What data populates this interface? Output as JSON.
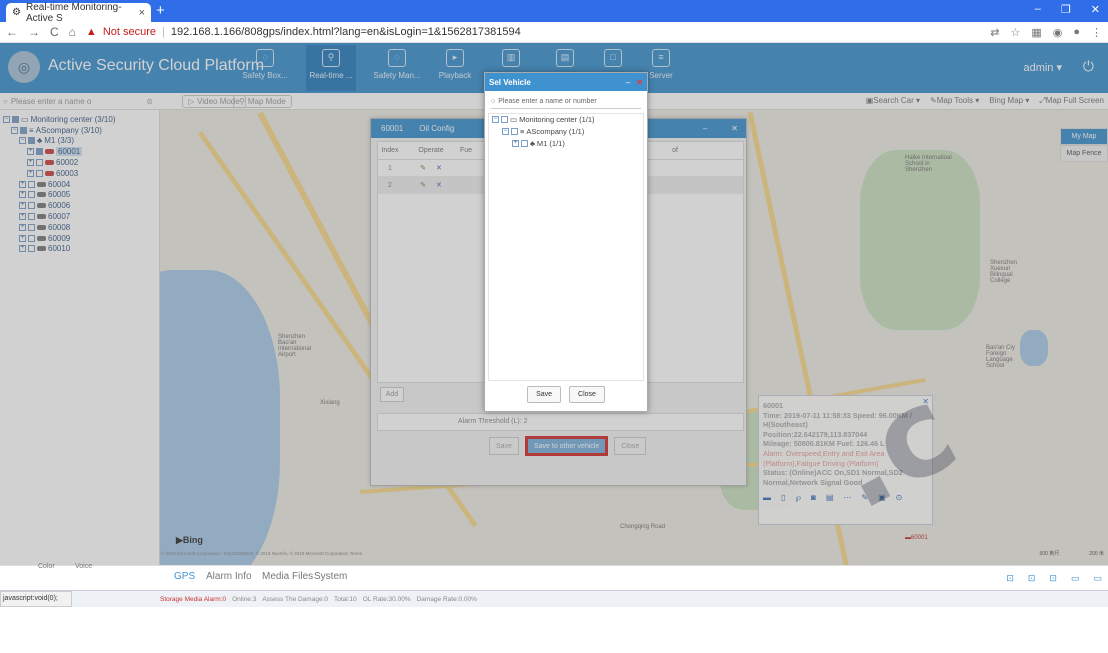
{
  "browser": {
    "tab_title": "Real-time Monitoring-Active S",
    "url": "192.168.1.166/808gps/index.html?lang=en&isLogin=1&1562817381594",
    "not_secure": "Not secure"
  },
  "header": {
    "title": "Active Security Cloud Platform",
    "nav": [
      {
        "label": "Safety Box..."
      },
      {
        "label": "Real-time ..."
      },
      {
        "label": "Safety Man..."
      },
      {
        "label": "Playback"
      },
      {
        "label": ""
      },
      {
        "label": ""
      },
      {
        "label": ""
      },
      {
        "label": "Server"
      }
    ],
    "user": "admin"
  },
  "toolbar": {
    "search_placeholder": "Please enter a name o",
    "video_mode": "Video Mode",
    "map_mode": "Map Mode",
    "search_car": "Search Car",
    "map_tools": "Map Tools",
    "bing_map": "Bing Map",
    "map_full_screen": "Map Full Screen"
  },
  "tree": {
    "root": "Monitoring center (3/10)",
    "company": "AScompany (3/10)",
    "group": "M1 (3/3)",
    "vehicles": [
      "60001",
      "60002",
      "60003",
      "60004",
      "60005",
      "60006",
      "60007",
      "60008",
      "60009",
      "60010"
    ]
  },
  "map": {
    "types": [
      "My Map",
      "Map Fence"
    ],
    "bing": "Bing",
    "copyright": "© 2019 Microsoft Corporation - GS(2018)5620, © 2019 NavInfo, © 2019 Microsoft Corporation",
    "terms": "Terms",
    "scale": [
      "500 英尺",
      "200 米"
    ],
    "labels": [
      "Shenzhen Bao'an International Airport",
      "Xixiang",
      "Haike Internatioal School in Shenzhen",
      "Shenzhen Xuexun Bilingual College",
      "Bao'an Ciy Foreign Language School",
      "Chongqing Road",
      "60001"
    ]
  },
  "info": {
    "vehicle": "60001",
    "time": "Time: 2019-07-11 11:58:33",
    "speed": "Speed: 96.00KM / H(Southeast)",
    "position": "Position:22.642179,113.837044",
    "mileage": "Mileage: 50800.81KM",
    "fuel": "Fuel: 126.46 L",
    "alarm": "Alarm: Overspeed,Entry and Exit Area (Platform),Fatigue Driving (Platform)",
    "status": "Status: (Online)ACC On,SD1 Normal,SD2 Normal,Network Signal Good"
  },
  "oil_dialog": {
    "vehicle": "60001",
    "title": "Oil Config",
    "columns": [
      "Index",
      "Operate",
      "Fue",
      "of"
    ],
    "rows": [
      {
        "index": "1"
      },
      {
        "index": "2"
      }
    ],
    "add": "Add",
    "threshold_label": "Alarm Threshold (L):",
    "threshold_value": "2",
    "save": "Save",
    "save_to_other": "Save to other vehicle",
    "close": "Close"
  },
  "sel_vehicle": {
    "title": "Sel Vehicle",
    "search_placeholder": "Please enter a name or number",
    "tree": [
      "Monitoring center (1/1)",
      "AScompany (1/1)",
      "M1 (1/1)"
    ],
    "save": "Save",
    "close": "Close"
  },
  "bottom": {
    "tabs": [
      "GPS",
      "Alarm Info",
      "Media Files",
      "System"
    ],
    "left_tabs": [
      "Color",
      "Voice"
    ],
    "status": {
      "media_alarm": "Storage Media Alarm:0",
      "online": "Online:3",
      "assess": "Assess The Damage:0",
      "total": "Total:10",
      "ol_rate": "OL Rate:30.00%",
      "damage_rate": "Damage Rate:0.00%"
    },
    "js_void": "javascript:void(0);"
  },
  "colors": {
    "header": "#3d92cf",
    "tabbar": "#2f6ee8",
    "highlight": "#d32f2f"
  }
}
